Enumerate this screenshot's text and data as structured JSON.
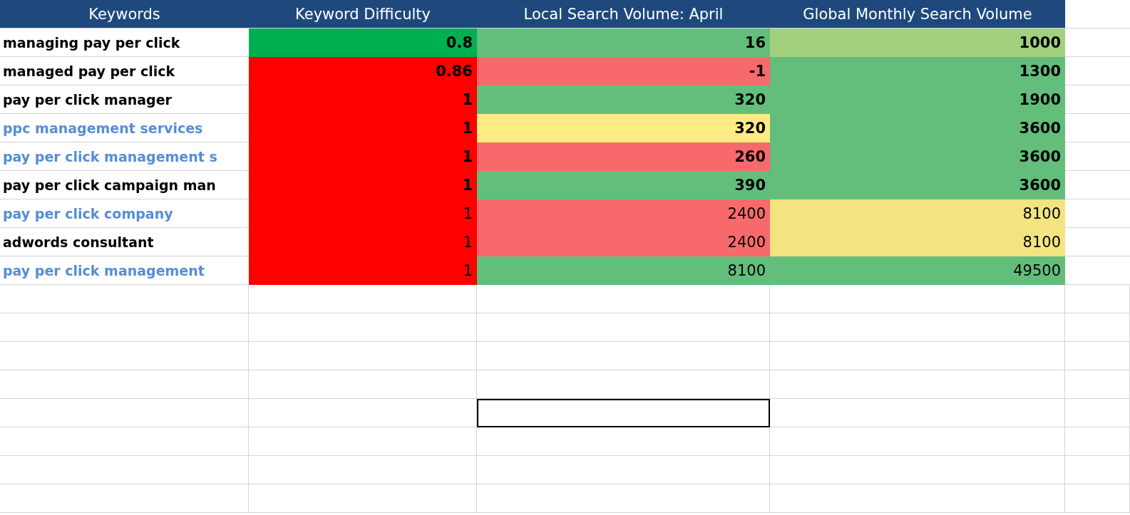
{
  "table": {
    "columns": [
      "Keywords",
      "Keyword Difficulty",
      "Local Search Volume: April",
      "Global Monthly Search Volume"
    ],
    "rows": [
      {
        "keyword": "managing pay per click",
        "color": "#000000",
        "bold": true,
        "cells": [
          {
            "value": "0.8",
            "color": "#00b050"
          },
          {
            "value": "16",
            "color": "#63be7b"
          },
          {
            "value": "1000",
            "color": "#a2d07f"
          }
        ]
      },
      {
        "keyword": "managed pay per click",
        "color": "#000000",
        "bold": true,
        "cells": [
          {
            "value": "0.86",
            "color": "#ff0000"
          },
          {
            "value": "-1",
            "color": "#f8696b"
          },
          {
            "value": "1300",
            "color": "#63be7b"
          }
        ]
      },
      {
        "keyword": "pay per click manager",
        "color": "#000000",
        "bold": true,
        "cells": [
          {
            "value": "1",
            "color": "#ff0000"
          },
          {
            "value": "320",
            "color": "#63be7b"
          },
          {
            "value": "1900",
            "color": "#63be7b"
          }
        ]
      },
      {
        "keyword": "ppc management services",
        "color": "#558ed5",
        "bold": true,
        "cells": [
          {
            "value": "1",
            "color": "#ff0000"
          },
          {
            "value": "320",
            "color": "#ffeb84"
          },
          {
            "value": "3600",
            "color": "#63be7b"
          }
        ]
      },
      {
        "keyword": "pay per click management s",
        "color": "#558ed5",
        "bold": true,
        "cells": [
          {
            "value": "1",
            "color": "#ff0000"
          },
          {
            "value": "260",
            "color": "#f8696b"
          },
          {
            "value": "3600",
            "color": "#63be7b"
          }
        ]
      },
      {
        "keyword": "pay per click campaign man",
        "color": "#000000",
        "bold": true,
        "cells": [
          {
            "value": "1",
            "color": "#ff0000"
          },
          {
            "value": "390",
            "color": "#63be7b"
          },
          {
            "value": "3600",
            "color": "#63be7b"
          }
        ]
      },
      {
        "keyword": "pay per click company",
        "color": "#558ed5",
        "bold": false,
        "cells": [
          {
            "value": "1",
            "color": "#ff0000"
          },
          {
            "value": "2400",
            "color": "#f8696b"
          },
          {
            "value": "8100",
            "color": "#f3e481"
          }
        ]
      },
      {
        "keyword": "adwords consultant",
        "color": "#000000",
        "bold": false,
        "cells": [
          {
            "value": "1",
            "color": "#ff0000"
          },
          {
            "value": "2400",
            "color": "#f8696b"
          },
          {
            "value": "8100",
            "color": "#f3e481"
          }
        ]
      },
      {
        "keyword": "pay per click management",
        "color": "#558ed5",
        "bold": false,
        "cells": [
          {
            "value": "1",
            "color": "#ff0000"
          },
          {
            "value": "8100",
            "color": "#63be7b"
          },
          {
            "value": "49500",
            "color": "#63be7b"
          }
        ]
      }
    ],
    "blank_rows": [
      {
        "cells": [
          {
            "selected": false
          },
          {
            "selected": false
          },
          {
            "selected": false
          },
          {
            "selected": false
          },
          {
            "selected": false
          }
        ]
      },
      {
        "cells": [
          {
            "selected": false
          },
          {
            "selected": false
          },
          {
            "selected": false
          },
          {
            "selected": false
          },
          {
            "selected": false
          }
        ]
      },
      {
        "cells": [
          {
            "selected": false
          },
          {
            "selected": false
          },
          {
            "selected": false
          },
          {
            "selected": false
          },
          {
            "selected": false
          }
        ]
      },
      {
        "cells": [
          {
            "selected": false
          },
          {
            "selected": false
          },
          {
            "selected": false
          },
          {
            "selected": false
          },
          {
            "selected": false
          }
        ]
      },
      {
        "cells": [
          {
            "selected": false
          },
          {
            "selected": false
          },
          {
            "selected": true
          },
          {
            "selected": false
          },
          {
            "selected": false
          }
        ]
      },
      {
        "cells": [
          {
            "selected": false
          },
          {
            "selected": false
          },
          {
            "selected": false
          },
          {
            "selected": false
          },
          {
            "selected": false
          }
        ]
      },
      {
        "cells": [
          {
            "selected": false
          },
          {
            "selected": false
          },
          {
            "selected": false
          },
          {
            "selected": false
          },
          {
            "selected": false
          }
        ]
      },
      {
        "cells": [
          {
            "selected": false
          },
          {
            "selected": false
          },
          {
            "selected": false
          },
          {
            "selected": false
          },
          {
            "selected": false
          }
        ]
      }
    ]
  }
}
